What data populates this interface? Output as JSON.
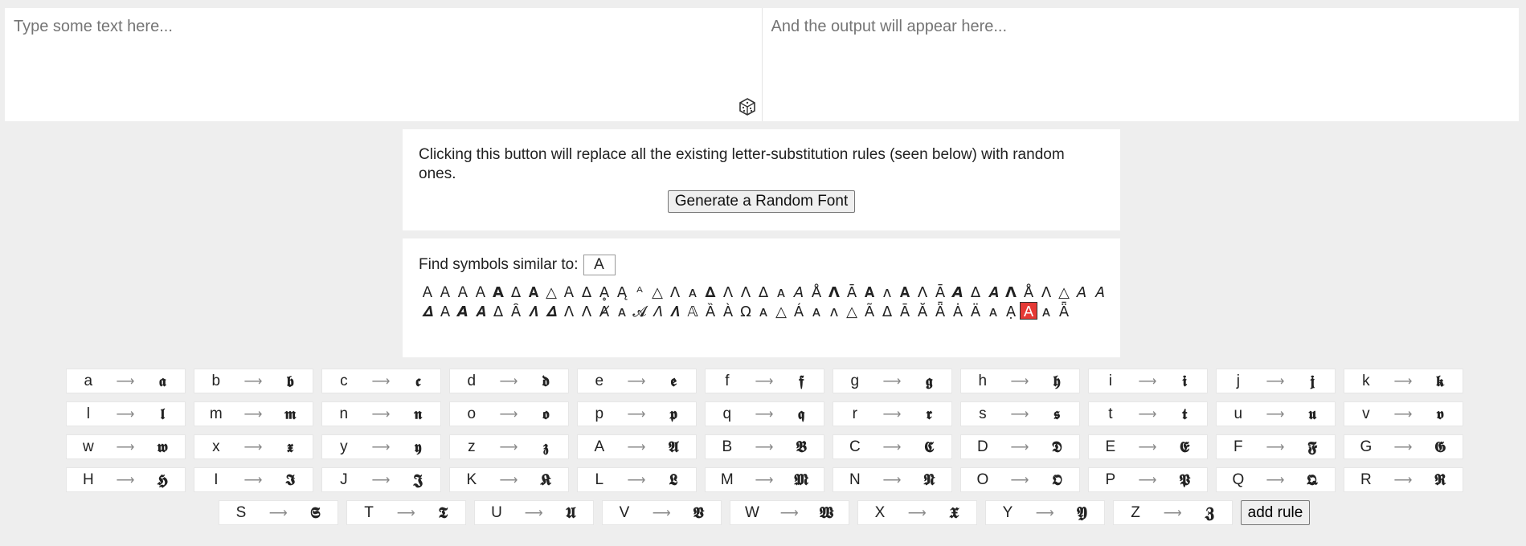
{
  "input": {
    "placeholder": "Type some text here..."
  },
  "output": {
    "placeholder": "And the output will appear here..."
  },
  "generator": {
    "description": "Clicking this button will replace all the existing letter-substitution rules (seen below) with random ones.",
    "button_label": "Generate a Random Font"
  },
  "finder": {
    "label": "Find symbols similar to:",
    "value": "A",
    "symbols": [
      "Ａ",
      "Ａ",
      "Ａ",
      "Ａ",
      "𝗔",
      "Δ",
      "𝐀",
      "△",
      "Ａ",
      "Δ",
      "Ḁ",
      "Ą",
      "ᴬ",
      "△",
      "Λ",
      "ᴀ",
      "𝚫",
      "Λ",
      "Λ",
      "Δ",
      "ᴀ",
      "𝘈",
      "Å",
      "𝝠",
      "Ā",
      "𝐀",
      "ʌ",
      "𝐀",
      "Λ",
      "Ā",
      "𝘼",
      "Δ",
      "𝑨",
      "𝝠",
      "Å",
      "Λ",
      "△",
      "𝘈",
      "𝐴",
      "𝜟",
      "𝖠",
      "𝘼",
      "𝑨",
      "Δ",
      "Ȃ",
      "𝜦",
      "𝜟",
      "Λ",
      "Λ",
      "Ⱥ",
      "ᴀ",
      "𝓐",
      "𝛬",
      "𝜦",
      "𝔸",
      "Ȁ",
      "À",
      "Ω",
      "ᴀ",
      "△",
      "Á",
      "ᴀ",
      "ʌ",
      "△",
      "Ã",
      "Δ",
      "Ā",
      "Ă",
      "Ǟ",
      "Ȧ",
      "Ä",
      "ᴀ",
      "Ạ",
      "A",
      "ᴀ",
      "Ǟ"
    ],
    "selected_index": 73
  },
  "rules": [
    {
      "from": "a",
      "to": "𝖆"
    },
    {
      "from": "b",
      "to": "𝖇"
    },
    {
      "from": "c",
      "to": "𝖈"
    },
    {
      "from": "d",
      "to": "𝖉"
    },
    {
      "from": "e",
      "to": "𝖊"
    },
    {
      "from": "f",
      "to": "𝖋"
    },
    {
      "from": "g",
      "to": "𝖌"
    },
    {
      "from": "h",
      "to": "𝖍"
    },
    {
      "from": "i",
      "to": "𝖎"
    },
    {
      "from": "j",
      "to": "𝖏"
    },
    {
      "from": "k",
      "to": "𝖐"
    },
    {
      "from": "l",
      "to": "𝖑"
    },
    {
      "from": "m",
      "to": "𝖒"
    },
    {
      "from": "n",
      "to": "𝖓"
    },
    {
      "from": "o",
      "to": "𝖔"
    },
    {
      "from": "p",
      "to": "𝖕"
    },
    {
      "from": "q",
      "to": "𝖖"
    },
    {
      "from": "r",
      "to": "𝖗"
    },
    {
      "from": "s",
      "to": "𝖘"
    },
    {
      "from": "t",
      "to": "𝖙"
    },
    {
      "from": "u",
      "to": "𝖚"
    },
    {
      "from": "v",
      "to": "𝖛"
    },
    {
      "from": "w",
      "to": "𝖜"
    },
    {
      "from": "x",
      "to": "𝖝"
    },
    {
      "from": "y",
      "to": "𝖞"
    },
    {
      "from": "z",
      "to": "𝖟"
    },
    {
      "from": "A",
      "to": "𝕬"
    },
    {
      "from": "B",
      "to": "𝕭"
    },
    {
      "from": "C",
      "to": "𝕮"
    },
    {
      "from": "D",
      "to": "𝕯"
    },
    {
      "from": "E",
      "to": "𝕰"
    },
    {
      "from": "F",
      "to": "𝕱"
    },
    {
      "from": "G",
      "to": "𝕲"
    },
    {
      "from": "H",
      "to": "𝕳"
    },
    {
      "from": "I",
      "to": "𝕴"
    },
    {
      "from": "J",
      "to": "𝕵"
    },
    {
      "from": "K",
      "to": "𝕶"
    },
    {
      "from": "L",
      "to": "𝕷"
    },
    {
      "from": "M",
      "to": "𝕸"
    },
    {
      "from": "N",
      "to": "𝕹"
    },
    {
      "from": "O",
      "to": "𝕺"
    },
    {
      "from": "P",
      "to": "𝕻"
    },
    {
      "from": "Q",
      "to": "𝕼"
    },
    {
      "from": "R",
      "to": "𝕽"
    },
    {
      "from": "S",
      "to": "𝕾"
    },
    {
      "from": "T",
      "to": "𝕿"
    },
    {
      "from": "U",
      "to": "𝖀"
    },
    {
      "from": "V",
      "to": "𝖁"
    },
    {
      "from": "W",
      "to": "𝖂"
    },
    {
      "from": "X",
      "to": "𝖃"
    },
    {
      "from": "Y",
      "to": "𝖄"
    },
    {
      "from": "Z",
      "to": "𝖅"
    }
  ],
  "rule_arrow": "⟶",
  "add_rule_label": "add rule",
  "icons": {
    "dice": "dice-icon"
  },
  "colors": {
    "selected_symbol": "#e53935"
  }
}
